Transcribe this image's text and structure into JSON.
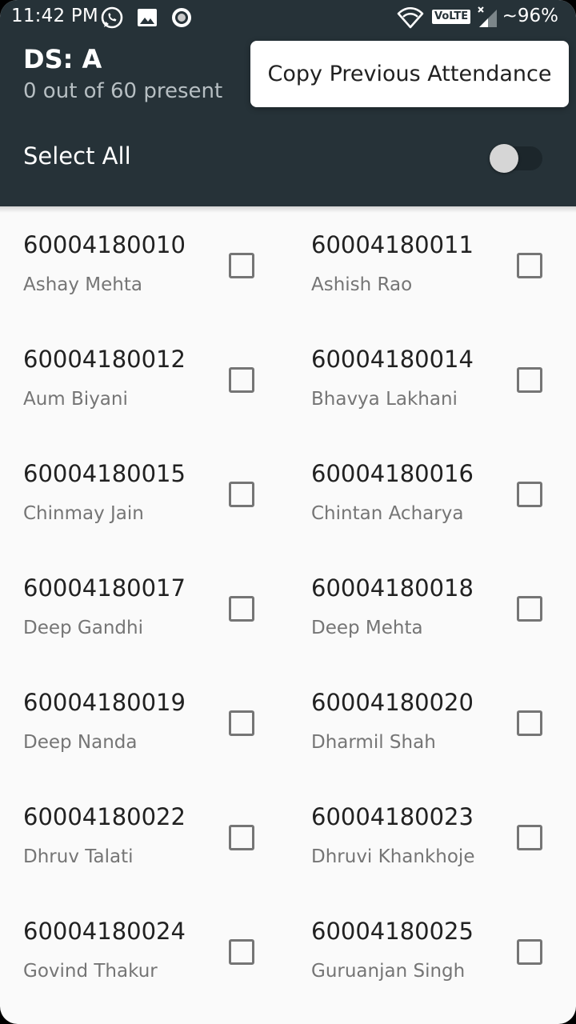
{
  "status_bar": {
    "time": "11:42 PM",
    "battery": "~96%",
    "icons": [
      "whatsapp-icon",
      "gallery-icon",
      "record-icon",
      "wifi-icon",
      "volte-icon",
      "signal-icon"
    ],
    "volte_label": "VoLTE"
  },
  "header": {
    "title": "DS: A",
    "subtitle": "0 out of 60 present",
    "select_all_label": "Select All",
    "select_all_on": false,
    "background_color": "#263238"
  },
  "popup": {
    "copy_label": "Copy Previous Attendance"
  },
  "students": [
    {
      "id": "60004180010",
      "name": "Ashay Mehta",
      "present": false
    },
    {
      "id": "60004180011",
      "name": "Ashish Rao",
      "present": false
    },
    {
      "id": "60004180012",
      "name": "Aum Biyani",
      "present": false
    },
    {
      "id": "60004180014",
      "name": "Bhavya Lakhani",
      "present": false
    },
    {
      "id": "60004180015",
      "name": "Chinmay Jain",
      "present": false
    },
    {
      "id": "60004180016",
      "name": "Chintan Acharya",
      "present": false
    },
    {
      "id": "60004180017",
      "name": "Deep Gandhi",
      "present": false
    },
    {
      "id": "60004180018",
      "name": "Deep Mehta",
      "present": false
    },
    {
      "id": "60004180019",
      "name": "Deep Nanda",
      "present": false
    },
    {
      "id": "60004180020",
      "name": "Dharmil Shah",
      "present": false
    },
    {
      "id": "60004180022",
      "name": "Dhruv Talati",
      "present": false
    },
    {
      "id": "60004180023",
      "name": "Dhruvi Khankhoje",
      "present": false
    },
    {
      "id": "60004180024",
      "name": "Govind Thakur",
      "present": false
    },
    {
      "id": "60004180025",
      "name": "Guruanjan Singh",
      "present": false
    }
  ]
}
